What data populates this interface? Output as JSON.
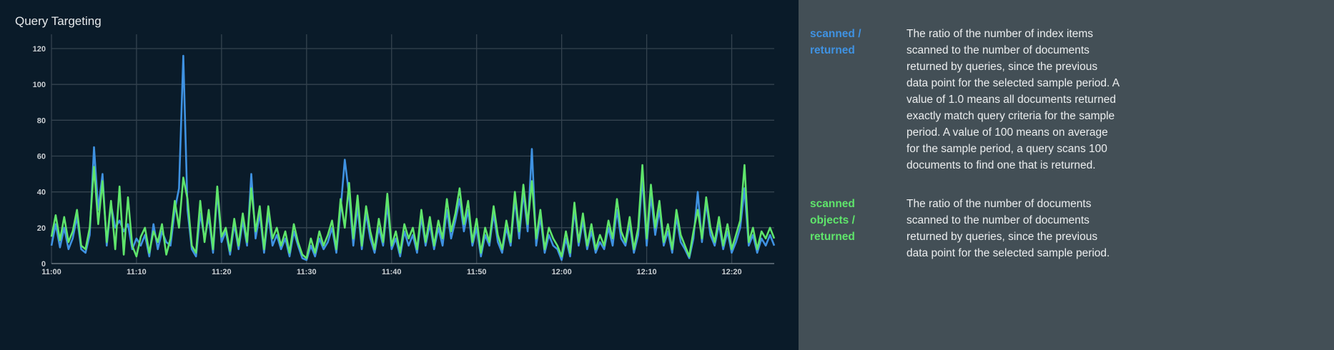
{
  "chart_data": {
    "type": "line",
    "title": "Query Targeting",
    "xlabel": "",
    "ylabel": "",
    "ylim": [
      0,
      120
    ],
    "yticks": [
      0,
      20,
      40,
      60,
      80,
      100,
      120
    ],
    "xlim_minutes": [
      0,
      85
    ],
    "xticks": [
      "11:00",
      "11:10",
      "11:20",
      "11:30",
      "11:40",
      "11:50",
      "12:00",
      "12:10",
      "12:20"
    ],
    "x_step_minutes": 0.5,
    "grid": true,
    "series": [
      {
        "name": "scanned / returned",
        "color": "#3f92e2",
        "values": [
          10,
          22,
          9,
          20,
          8,
          14,
          26,
          8,
          6,
          16,
          65,
          30,
          50,
          10,
          33,
          20,
          24,
          18,
          22,
          8,
          14,
          10,
          16,
          4,
          22,
          8,
          18,
          12,
          10,
          30,
          42,
          116,
          30,
          8,
          4,
          28,
          14,
          26,
          6,
          40,
          12,
          18,
          5,
          22,
          8,
          24,
          10,
          50,
          14,
          28,
          6,
          28,
          10,
          16,
          8,
          14,
          4,
          18,
          10,
          3,
          2,
          10,
          4,
          14,
          8,
          12,
          20,
          6,
          30,
          58,
          38,
          10,
          32,
          8,
          28,
          14,
          6,
          20,
          10,
          33,
          8,
          14,
          4,
          18,
          10,
          16,
          6,
          26,
          10,
          22,
          8,
          20,
          10,
          30,
          14,
          24,
          36,
          18,
          30,
          10,
          20,
          4,
          16,
          10,
          28,
          12,
          6,
          20,
          10,
          36,
          14,
          40,
          18,
          64,
          10,
          26,
          6,
          16,
          10,
          8,
          2,
          14,
          4,
          30,
          10,
          24,
          8,
          18,
          6,
          12,
          8,
          20,
          10,
          30,
          14,
          10,
          22,
          6,
          16,
          48,
          10,
          38,
          16,
          30,
          10,
          18,
          6,
          26,
          12,
          8,
          3,
          14,
          40,
          12,
          34,
          16,
          10,
          22,
          8,
          18,
          6,
          12,
          20,
          42,
          10,
          16,
          6,
          14,
          10,
          16,
          10
        ]
      },
      {
        "name": "scanned objects / returned",
        "color": "#5fe56b",
        "values": [
          15,
          27,
          13,
          26,
          12,
          18,
          30,
          10,
          8,
          20,
          54,
          22,
          46,
          12,
          35,
          8,
          43,
          5,
          37,
          10,
          4,
          15,
          20,
          6,
          18,
          12,
          22,
          5,
          14,
          35,
          20,
          48,
          36,
          10,
          6,
          35,
          12,
          30,
          8,
          43,
          15,
          20,
          7,
          25,
          10,
          28,
          12,
          42,
          18,
          32,
          8,
          32,
          14,
          20,
          10,
          18,
          6,
          22,
          12,
          5,
          3,
          14,
          6,
          18,
          10,
          16,
          24,
          8,
          36,
          20,
          45,
          14,
          38,
          10,
          32,
          18,
          8,
          25,
          12,
          39,
          10,
          18,
          6,
          22,
          14,
          20,
          8,
          30,
          12,
          26,
          10,
          24,
          14,
          36,
          18,
          28,
          42,
          22,
          35,
          12,
          25,
          6,
          20,
          12,
          32,
          16,
          8,
          24,
          12,
          40,
          18,
          44,
          22,
          46,
          14,
          30,
          8,
          20,
          14,
          10,
          4,
          18,
          6,
          34,
          12,
          28,
          10,
          22,
          8,
          16,
          10,
          24,
          14,
          36,
          18,
          12,
          26,
          8,
          20,
          55,
          14,
          44,
          20,
          35,
          12,
          22,
          8,
          30,
          16,
          10,
          4,
          18,
          30,
          14,
          37,
          20,
          12,
          26,
          10,
          22,
          8,
          16,
          24,
          55,
          12,
          20,
          8,
          18,
          14,
          20,
          14
        ]
      }
    ]
  },
  "legend": [
    {
      "label_line1": "scanned /",
      "label_line2": "returned",
      "color": "#3f92e2",
      "description": "The ratio of the number of index items scanned to the number of documents returned by queries, since the previous data point for the selected sample period. A value of 1.0 means all documents returned exactly match query criteria for the sample period. A value of 100 means on average for the sample period, a query scans 100 documents to find one that is returned."
    },
    {
      "label_line1": "scanned",
      "label_line2": "objects /",
      "label_line3": "returned",
      "color": "#5fe56b",
      "description": "The ratio of the number of documents scanned to the number of documents returned by queries, since the previous data point for the selected sample period."
    }
  ]
}
